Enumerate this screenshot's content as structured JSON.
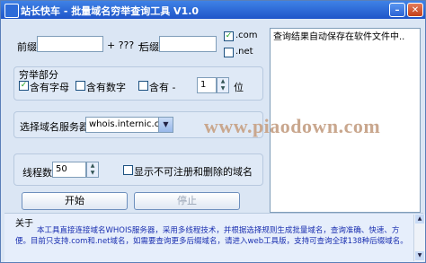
{
  "titlebar": {
    "title": "站长快车 - 批量域名穷举查询工具 V1.0",
    "min_icon": "minimize-icon",
    "close_icon": "close-icon"
  },
  "prefix": {
    "label": "前缀",
    "value": ""
  },
  "middle_text": "+ ??? +",
  "suffix": {
    "label": "后缀",
    "value": ""
  },
  "tld": {
    "com": {
      "label": ".com",
      "checked": true
    },
    "net": {
      "label": ".net",
      "checked": false
    }
  },
  "exhaust": {
    "title": "穷举部分",
    "letters": {
      "label": "含有字母",
      "checked": true
    },
    "digits": {
      "label": "含有数字",
      "checked": false
    },
    "dash": {
      "label": "含有 -",
      "checked": false
    },
    "count_value": "1",
    "count_unit": "位"
  },
  "server": {
    "label": "选择域名服务器",
    "value": "whois.internic.com"
  },
  "threads": {
    "label": "线程数",
    "value": "50"
  },
  "show_unregistered": {
    "label": "显示不可注册和删除的域名",
    "checked": false
  },
  "buttons": {
    "start": "开始",
    "stop": "停止"
  },
  "result": {
    "text": "查询结果自动保存在软件文件中.."
  },
  "watermark": "www.piaodown.com",
  "about": {
    "title": "关于",
    "text": "本工具直接连接域名WHOIS服务器，采用多线程技术，并根据选择规则生成批量域名，查询准确、快速、方便。目前只支持.com和.net域名，如需要查询更多后缀域名，请进入web工具版，支持可查询全球138种后缀域名。"
  }
}
